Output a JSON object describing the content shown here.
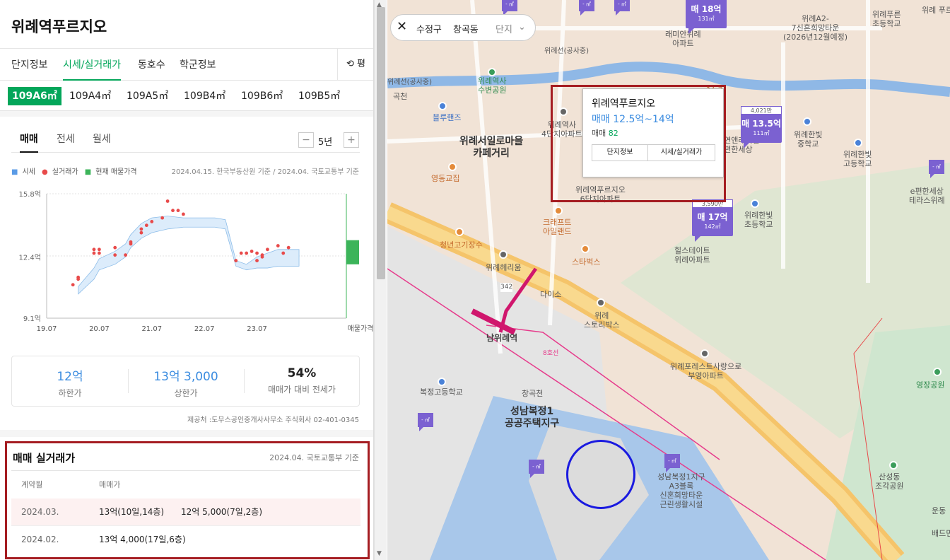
{
  "panel": {
    "title": "위례역푸르지오",
    "tabs": [
      "단지정보",
      "시세/실거래가",
      "동호수",
      "학군정보"
    ],
    "pyeong_label": "평",
    "types": [
      "109A6㎡",
      "109A4㎡",
      "109A5㎡",
      "109B4㎡",
      "109B6㎡",
      "109B5㎡"
    ],
    "subtabs": [
      "매매",
      "전세",
      "월세"
    ],
    "period": "5년",
    "legend": [
      "시세",
      "실거래가",
      "현재 매물가격"
    ],
    "basis": "2024.04.15. 한국부동산원 기준 / 2024.04. 국토교통부 기준",
    "stats": [
      {
        "value": "12억",
        "label": "하한가"
      },
      {
        "value": "13억 3,000",
        "label": "상한가"
      },
      {
        "value": "54%",
        "label": "매매가 대비 전세가"
      }
    ],
    "provider": "제공처 :도무스공인중개사사무소 주식회사 02-401-0345",
    "deals": {
      "title": "매매 실거래가",
      "basis": "2024.04. 국토교통부 기준",
      "col_month": "계약월",
      "col_price": "매매가",
      "rows": [
        {
          "month": "2024.03.",
          "price1": "13억(10일,14층)",
          "price2": "12억 5,000(7일,2층)"
        },
        {
          "month": "2024.02.",
          "price1": "13억 4,000(17일,6층)",
          "price2": ""
        }
      ]
    }
  },
  "chart_data": {
    "type": "line",
    "ylabels": [
      "15.8억",
      "12.4억",
      "9.1억"
    ],
    "xlabels": [
      "19.07",
      "20.07",
      "21.07",
      "22.07",
      "23.07",
      "매물가격"
    ],
    "ylim": [
      9.1,
      15.8
    ],
    "band_x": [
      19.6,
      19.9,
      20.0,
      20.3,
      20.5,
      20.6,
      20.8,
      21.0,
      21.3,
      21.6,
      21.9,
      22.2,
      22.4,
      22.6,
      22.8,
      23.0,
      23.2,
      23.4,
      23.5,
      23.8
    ],
    "band_low": [
      10.4,
      11.2,
      11.7,
      12.0,
      12.4,
      12.9,
      13.4,
      13.7,
      13.9,
      14.0,
      14.0,
      14.0,
      13.9,
      11.9,
      11.7,
      11.8,
      11.8,
      11.9,
      11.9,
      11.9
    ],
    "band_high": [
      10.8,
      11.8,
      12.3,
      12.7,
      13.1,
      13.6,
      14.2,
      14.5,
      14.6,
      14.5,
      14.5,
      14.5,
      14.4,
      12.2,
      12.0,
      12.4,
      12.6,
      12.8,
      12.8,
      12.8
    ],
    "real_points": [
      [
        19.5,
        10.9
      ],
      [
        19.6,
        11.2
      ],
      [
        19.6,
        11.3
      ],
      [
        19.9,
        12.6
      ],
      [
        19.9,
        12.8
      ],
      [
        20.0,
        12.6
      ],
      [
        20.0,
        12.8
      ],
      [
        20.3,
        12.5
      ],
      [
        20.3,
        12.9
      ],
      [
        20.5,
        12.5
      ],
      [
        20.6,
        13.1
      ],
      [
        20.6,
        13.2
      ],
      [
        20.8,
        13.7
      ],
      [
        20.8,
        13.9
      ],
      [
        20.9,
        14.1
      ],
      [
        21.0,
        14.3
      ],
      [
        21.2,
        14.5
      ],
      [
        21.3,
        15.4
      ],
      [
        21.4,
        14.9
      ],
      [
        21.5,
        14.9
      ],
      [
        21.6,
        14.7
      ],
      [
        22.6,
        12.2
      ],
      [
        22.7,
        12.6
      ],
      [
        22.8,
        12.6
      ],
      [
        22.9,
        12.7
      ],
      [
        23.0,
        12.2
      ],
      [
        23.0,
        12.6
      ],
      [
        23.1,
        12.4
      ],
      [
        23.1,
        12.5
      ],
      [
        23.2,
        12.8
      ],
      [
        23.4,
        13.0
      ],
      [
        23.5,
        12.6
      ],
      [
        23.6,
        12.9
      ]
    ],
    "listing": [
      12.0,
      13.3
    ]
  },
  "map": {
    "breadcrumb": [
      "수정구",
      "창곡동",
      "단지"
    ],
    "popup": {
      "name": "위례역푸르지오",
      "range": "매매 12.5억~14억",
      "count_label": "매매",
      "count": "82",
      "btn1": "단지정보",
      "btn2": "시세/실거래가"
    },
    "markers": [
      {
        "top": "4,021만",
        "price": "매 13.5억",
        "area": "111㎡"
      },
      {
        "top": "3,590만",
        "price": "매 17억",
        "area": "142㎡"
      },
      {
        "top": "",
        "price": "매 18억",
        "area": "131㎡"
      }
    ],
    "labels": {
      "l1": "위례A2-\n7신혼희망타운\n(2026년12월예정)",
      "l2": "위례푸른\n초등학교",
      "l3": "위례 푸르",
      "l4": "래미안위례\n아파트",
      "l5": "위례선(공사중)",
      "l6": "위례역사\n수변공원",
      "l7": "37.5",
      "l8": "블루핸즈",
      "l9": "위례서일로마을\n카페거리",
      "l10": "위례한빛\n중학교",
      "l11": "위례한빛\n고등학교",
      "l12": "자연앤래미안\n편한세상",
      "l13": "e편한세상\n테라스위례",
      "l14": "영동교집",
      "l15": "위례역푸르지오\n6단지아파트",
      "l16": "위례한빛\n초등학교",
      "l17": "크래프트\n아일랜드",
      "l18": "청년고기장수",
      "l19": "스타벅스",
      "l20": "힐스테이트\n위례아파트",
      "l21": "위례헤리움",
      "l22": "다이소",
      "l23": "위례\n스토리박스",
      "l24": "남위례역",
      "l25": "위례포레스트사랑으로\n부영아파트",
      "l26": "복정고등학교",
      "l27": "창곡천",
      "l28": "성남복정1\n공공주택지구",
      "l29": "성남복정1지구\nA3블록\n신혼희망타운\n근린생활시설",
      "l30": "영장공원",
      "l31": "산성동\n조각공원",
      "l32": "위례역사\n4단지아파트",
      "l33": "곡천",
      "l34": "위례선(공사중)",
      "l35": "8호선",
      "l36": "342",
      "l37": "운동",
      "l38": "배드민"
    },
    "small_marker": "- ㎡"
  },
  "colors": {
    "accent": "#03a65a",
    "popup_blue": "#3b8ce0",
    "marker": "#7b61d1",
    "annotation_red": "#a51d22",
    "annotation_blue": "#1a1ae0"
  }
}
